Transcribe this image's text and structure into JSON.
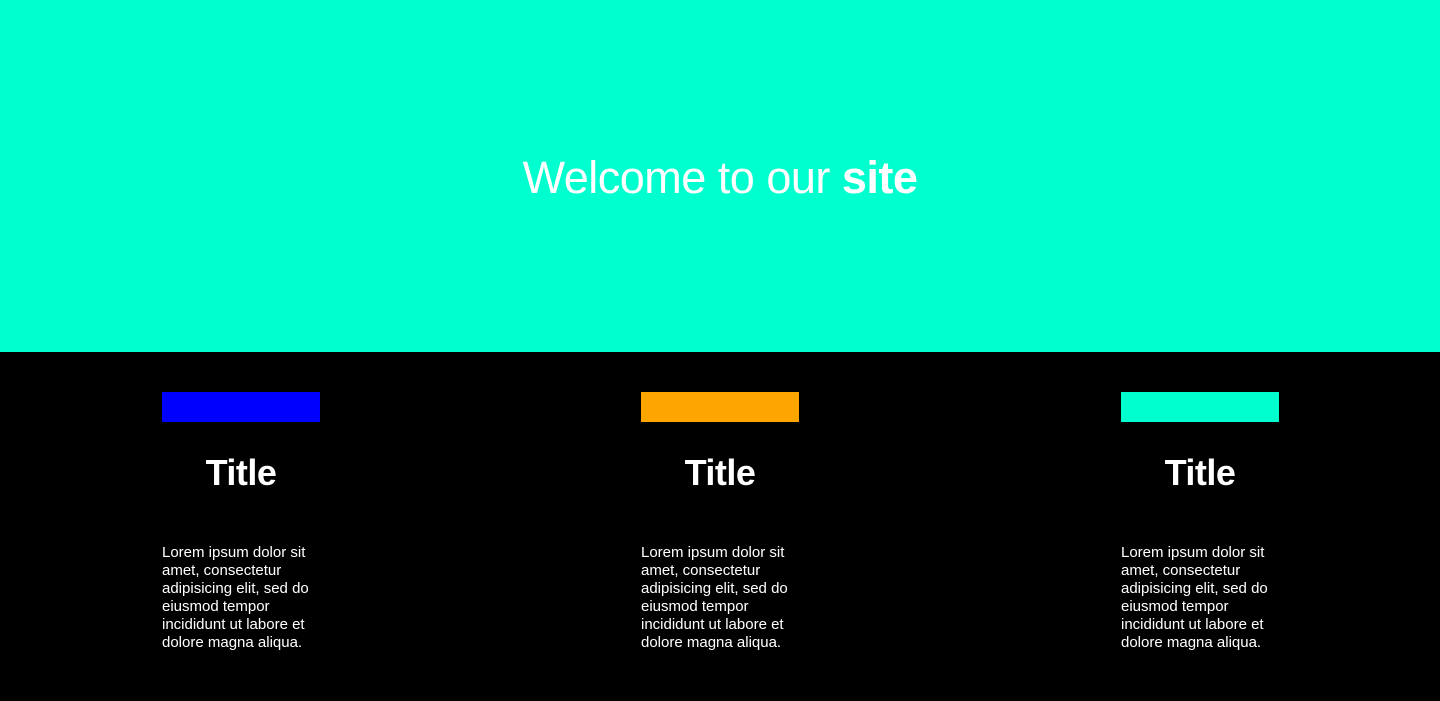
{
  "hero": {
    "title_light": "Welcome to our ",
    "title_bold": "site",
    "background": "#00ffcf"
  },
  "features": [
    {
      "color": "#0000ff",
      "title": "Title",
      "text": "Lorem ipsum dolor sit amet, consectetur adipisicing elit, sed do eiusmod tempor incididunt ut labore et dolore magna aliqua."
    },
    {
      "color": "#ffa500",
      "title": "Title",
      "text": "Lorem ipsum dolor sit amet, consectetur adipisicing elit, sed do eiusmod tempor incididunt ut labore et dolore magna aliqua."
    },
    {
      "color": "#00ffcf",
      "title": "Title",
      "text": "Lorem ipsum dolor sit amet, consectetur adipisicing elit, sed do eiusmod tempor incididunt ut labore et dolore magna aliqua."
    }
  ]
}
